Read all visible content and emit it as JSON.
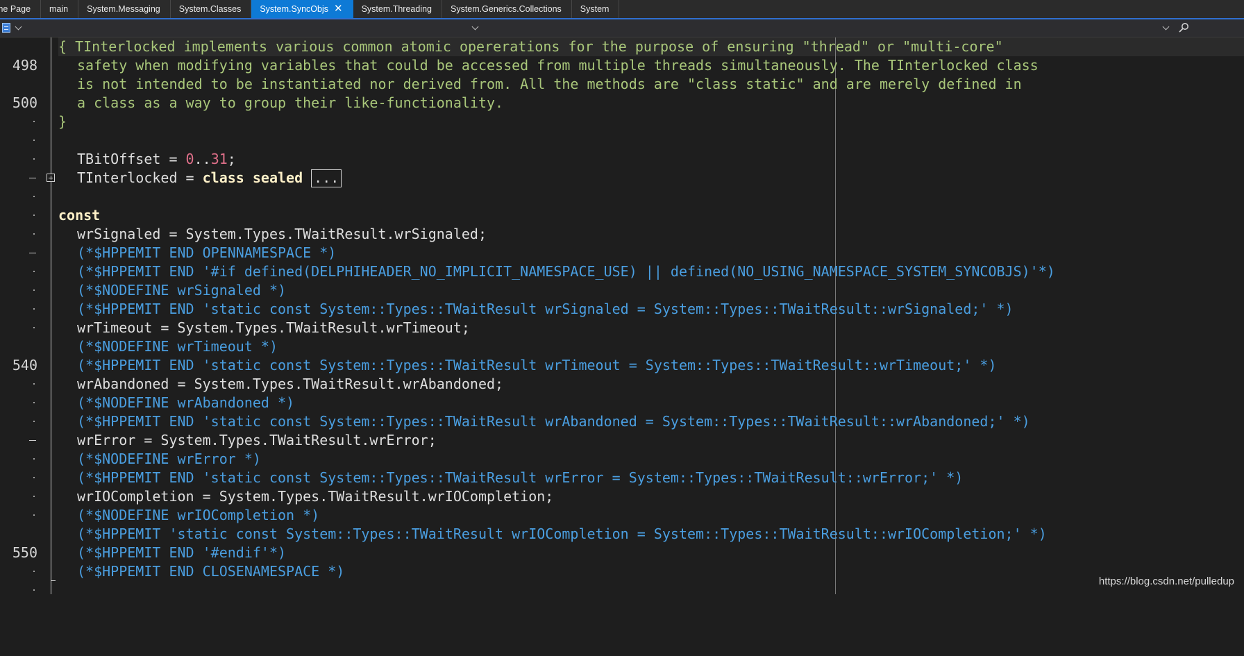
{
  "tabs": [
    {
      "label": "me Page"
    },
    {
      "label": "main"
    },
    {
      "label": "System.Messaging"
    },
    {
      "label": "System.Classes"
    },
    {
      "label": "System.SyncObjs",
      "active": true,
      "close_glyph": "✕"
    },
    {
      "label": "System.Threading"
    },
    {
      "label": "System.Generics.Collections"
    },
    {
      "label": "System"
    }
  ],
  "gutter": {
    "labels": [
      "498",
      "500",
      "540",
      "550"
    ]
  },
  "code": {
    "comment_line1": "{ TInterlocked implements various common atomic opererations for the purpose of ensuring \"thread\" or \"multi-core\"",
    "comment_line2": "safety when modifying variables that could be accessed from multiple threads simultaneously. The TInterlocked class",
    "comment_line3": "is not intended to be instantiated nor derived from. All the methods are \"class static\" and are merely defined in",
    "comment_line4": "a class as a way to group their like-functionality.",
    "comment_close": "}",
    "bitoffset_name": "TBitOffset = ",
    "bitoffset_low": "0",
    "bitoffset_range": "..",
    "bitoffset_high": "31",
    "bitoffset_end": ";",
    "interlocked_name": "TInterlocked = ",
    "interlocked_keyword": "class sealed",
    "interlocked_collapsed": "...",
    "const_keyword": "const",
    "l_wrSignaled": "wrSignaled = System.Types.TWaitResult.wrSignaled;",
    "l_open_ns": "(*$HPPEMIT END OPENNAMESPACE *)",
    "l_if_defined": "(*$HPPEMIT END '#if defined(DELPHIHEADER_NO_IMPLICIT_NAMESPACE_USE) || defined(NO_USING_NAMESPACE_SYSTEM_SYNCOBJS)'*)",
    "l_nodef_signaled": "(*$NODEFINE wrSignaled *)",
    "l_emit_signaled": "(*$HPPEMIT END 'static const System::Types::TWaitResult wrSignaled = System::Types::TWaitResult::wrSignaled;' *)",
    "l_wrTimeout": "wrTimeout = System.Types.TWaitResult.wrTimeout;",
    "l_nodef_timeout": "(*$NODEFINE wrTimeout *)",
    "l_emit_timeout": "(*$HPPEMIT END 'static const System::Types::TWaitResult wrTimeout = System::Types::TWaitResult::wrTimeout;' *)",
    "l_wrAbandoned": "wrAbandoned = System.Types.TWaitResult.wrAbandoned;",
    "l_nodef_abandoned": "(*$NODEFINE wrAbandoned *)",
    "l_emit_abandoned": "(*$HPPEMIT END 'static const System::Types::TWaitResult wrAbandoned = System::Types::TWaitResult::wrAbandoned;' *)",
    "l_wrError": "wrError = System.Types.TWaitResult.wrError;",
    "l_nodef_error": "(*$NODEFINE wrError *)",
    "l_emit_error": "(*$HPPEMIT END 'static const System::Types::TWaitResult wrError = System::Types::TWaitResult::wrError;' *)",
    "l_wrIOCompletion": "wrIOCompletion = System.Types.TWaitResult.wrIOCompletion;",
    "l_nodef_iocompletion": "(*$NODEFINE wrIOCompletion *)",
    "l_emit_iocompletion": "(*$HPPEMIT 'static const System::Types::TWaitResult wrIOCompletion = System::Types::TWaitResult::wrIOCompletion;' *)",
    "l_endif": "(*$HPPEMIT END '#endif'*)",
    "l_close_ns": "(*$HPPEMIT END CLOSENAMESPACE *)"
  },
  "watermark": "https://blog.csdn.net/pulledup",
  "colors": {
    "accent_tab": "#0e7ad6",
    "comment": "#a9c77a",
    "directive": "#4a9ee0",
    "keyword": "#fff1c8",
    "number": "#e0708a",
    "background": "#1e1e1e"
  },
  "icons": [
    "doc-icon",
    "chevron-down-icon",
    "search-icon",
    "close-icon",
    "fold-expand-icon"
  ]
}
